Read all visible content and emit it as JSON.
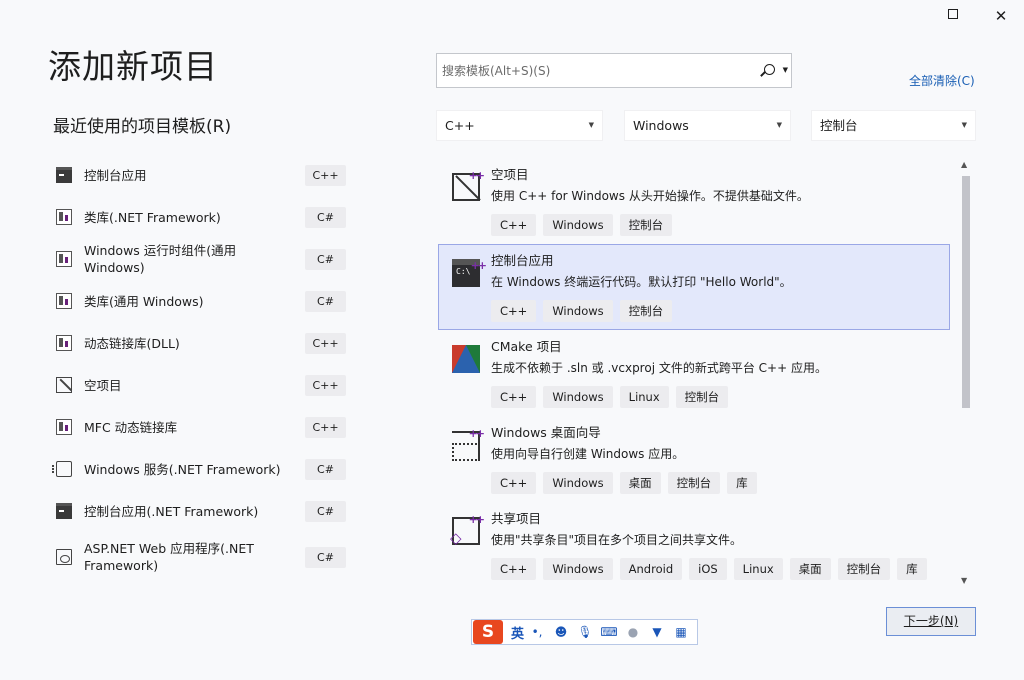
{
  "window": {
    "maximize_label": "☐",
    "close_label": "✕"
  },
  "header": {
    "title": "添加新项目",
    "recent_heading": "最近使用的项目模板(R)"
  },
  "recent_templates": [
    {
      "label": "控制台应用",
      "lang": "C++",
      "icon": "console-icon"
    },
    {
      "label": "类库(.NET Framework)",
      "lang": "C#",
      "icon": "class-library-icon"
    },
    {
      "label": "Windows 运行时组件(通用 Windows)",
      "lang": "C#",
      "icon": "class-library-icon"
    },
    {
      "label": "类库(通用 Windows)",
      "lang": "C#",
      "icon": "class-library-icon"
    },
    {
      "label": "动态链接库(DLL)",
      "lang": "C++",
      "icon": "class-library-icon"
    },
    {
      "label": "空项目",
      "lang": "C++",
      "icon": "empty-project-icon"
    },
    {
      "label": "MFC 动态链接库",
      "lang": "C++",
      "icon": "class-library-icon"
    },
    {
      "label": "Windows 服务(.NET Framework)",
      "lang": "C#",
      "icon": "service-icon"
    },
    {
      "label": "控制台应用(.NET Framework)",
      "lang": "C#",
      "icon": "console-icon"
    },
    {
      "label": "ASP.NET Web 应用程序(.NET Framework)",
      "lang": "C#",
      "icon": "web-app-icon"
    }
  ],
  "search": {
    "placeholder": "搜索模板(Alt+S)(S)",
    "value": ""
  },
  "clear_all": "全部清除(C)",
  "filters": {
    "language": "C++",
    "platform": "Windows",
    "project_type": "控制台"
  },
  "templates": [
    {
      "title": "空项目",
      "description": "使用 C++ for Windows 从头开始操作。不提供基础文件。",
      "tags": [
        "C++",
        "Windows",
        "控制台"
      ],
      "icon": "empty-project-icon",
      "selected": false
    },
    {
      "title": "控制台应用",
      "description": "在 Windows 终端运行代码。默认打印 \"Hello World\"。",
      "tags": [
        "C++",
        "Windows",
        "控制台"
      ],
      "icon": "console-app-icon",
      "selected": true
    },
    {
      "title": "CMake 项目",
      "description": "生成不依赖于 .sln 或 .vcxproj 文件的新式跨平台 C++ 应用。",
      "tags": [
        "C++",
        "Windows",
        "Linux",
        "控制台"
      ],
      "icon": "cmake-icon",
      "selected": false
    },
    {
      "title": "Windows 桌面向导",
      "description": "使用向导自行创建 Windows 应用。",
      "tags": [
        "C++",
        "Windows",
        "桌面",
        "控制台",
        "库"
      ],
      "icon": "desktop-wizard-icon",
      "selected": false
    },
    {
      "title": "共享项目",
      "description": "使用\"共享条目\"项目在多个项目之间共享文件。",
      "tags": [
        "C++",
        "Windows",
        "Android",
        "iOS",
        "Linux",
        "桌面",
        "控制台",
        "库"
      ],
      "icon": "shared-project-icon",
      "selected": false
    }
  ],
  "next_button": {
    "label": "下一步",
    "accel": "(N)"
  },
  "ime": {
    "logo": "S",
    "lang": "英"
  }
}
